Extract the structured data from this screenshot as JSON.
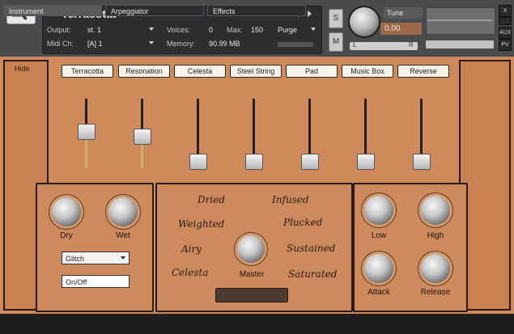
{
  "header": {
    "title": "Terracotta",
    "output_label": "Output:",
    "output_value": "st. 1",
    "midi_label": "Midi Ch:",
    "midi_value": "[A]  1",
    "voices_label": "Voices:",
    "voices_value": "0",
    "max_label": "Max:",
    "max_value": "150",
    "purge_label": "Purge",
    "memory_label": "Memory:",
    "memory_value": "90.99 MB",
    "s_label": "S",
    "m_label": "M",
    "tune_label": "Tune",
    "tune_value": "0.00",
    "pan_l": "L",
    "pan_r": "R",
    "aux_label": "AUX",
    "pv_label": "PV",
    "close_label": "X"
  },
  "main": {
    "hide_label": "Hide",
    "presets": [
      "Terracotta",
      "Resonation",
      "Celesta",
      "Steel String",
      "Pad",
      "Music Box",
      "Reverse"
    ],
    "slider_levels": [
      0.55,
      0.45,
      0.0,
      0.0,
      0.0,
      0.0,
      0.0
    ],
    "left_box": {
      "knob_labels": [
        "Dry",
        "Wet"
      ],
      "dropdown_value": "Glitch",
      "onoff_label": "On/Off"
    },
    "center_box": {
      "words": [
        "Dried",
        "Infused",
        "Weighted",
        "Plucked",
        "Airy",
        "Sustained",
        "Celesta",
        "Saturated"
      ],
      "master_label": "Master"
    },
    "right_box": {
      "knob_labels": [
        "Low",
        "High",
        "Attack",
        "Release"
      ]
    }
  },
  "tabs": [
    "Instrument",
    "Arpeggiator",
    "Effects"
  ]
}
